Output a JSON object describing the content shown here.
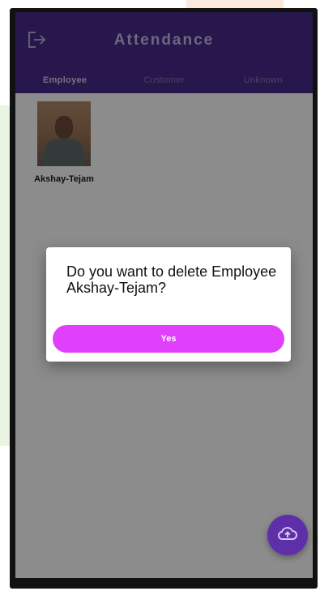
{
  "app": {
    "title": "Attendance"
  },
  "tabs": [
    {
      "label": "Employee",
      "active": true
    },
    {
      "label": "Customer",
      "active": false
    },
    {
      "label": "Unknown",
      "active": false
    }
  ],
  "employees": [
    {
      "name": "Akshay-Tejam"
    }
  ],
  "dialog": {
    "message": "Do you want to delete Employee Akshay-Tejam?",
    "confirm_label": "Yes"
  },
  "icons": {
    "logout": "logout-icon",
    "fab": "cloud-upload-icon"
  },
  "colors": {
    "app_bar": "#4a2a8a",
    "confirm_button": "#e040fb",
    "fab": "#5e2fa8"
  }
}
